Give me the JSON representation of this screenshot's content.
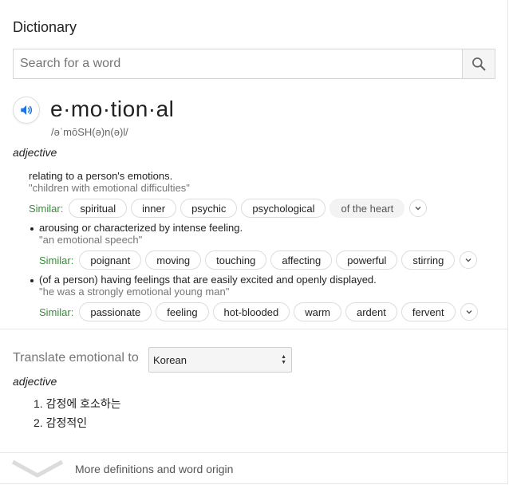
{
  "header": {
    "title": "Dictionary"
  },
  "search": {
    "placeholder": "Search for a word",
    "button_icon": "search-icon"
  },
  "entry": {
    "word": "e·mo·tion·al",
    "phonetic": "/əˈmōSH(ə)n(ə)l/",
    "speaker_icon": "speaker-icon",
    "part_of_speech": "adjective",
    "senses": [
      {
        "definition": "relating to a person's emotions.",
        "example": "\"children with emotional difficulties\"",
        "similar_label": "Similar:",
        "similar": [
          "spiritual",
          "inner",
          "psychic",
          "psychological",
          "of the heart"
        ]
      },
      {
        "definition": "arousing or characterized by intense feeling.",
        "example": "\"an emotional speech\"",
        "similar_label": "Similar:",
        "similar": [
          "poignant",
          "moving",
          "touching",
          "affecting",
          "powerful",
          "stirring"
        ]
      },
      {
        "definition": "(of a person) having feelings that are easily excited and openly displayed.",
        "example": "\"he was a strongly emotional young man\"",
        "similar_label": "Similar:",
        "similar": [
          "passionate",
          "feeling",
          "hot-blooded",
          "warm",
          "ardent",
          "fervent"
        ]
      }
    ]
  },
  "translate": {
    "label": "Translate emotional to",
    "language": "Korean",
    "part_of_speech": "adjective",
    "items": [
      "1. 감정에 호소하는",
      "2. 감정적인"
    ]
  },
  "footer": {
    "more_label": "More definitions and word origin",
    "icon": "chevron-down-icon"
  },
  "colors": {
    "similar_label": "#3c8a3b",
    "speaker": "#1a73e8"
  }
}
